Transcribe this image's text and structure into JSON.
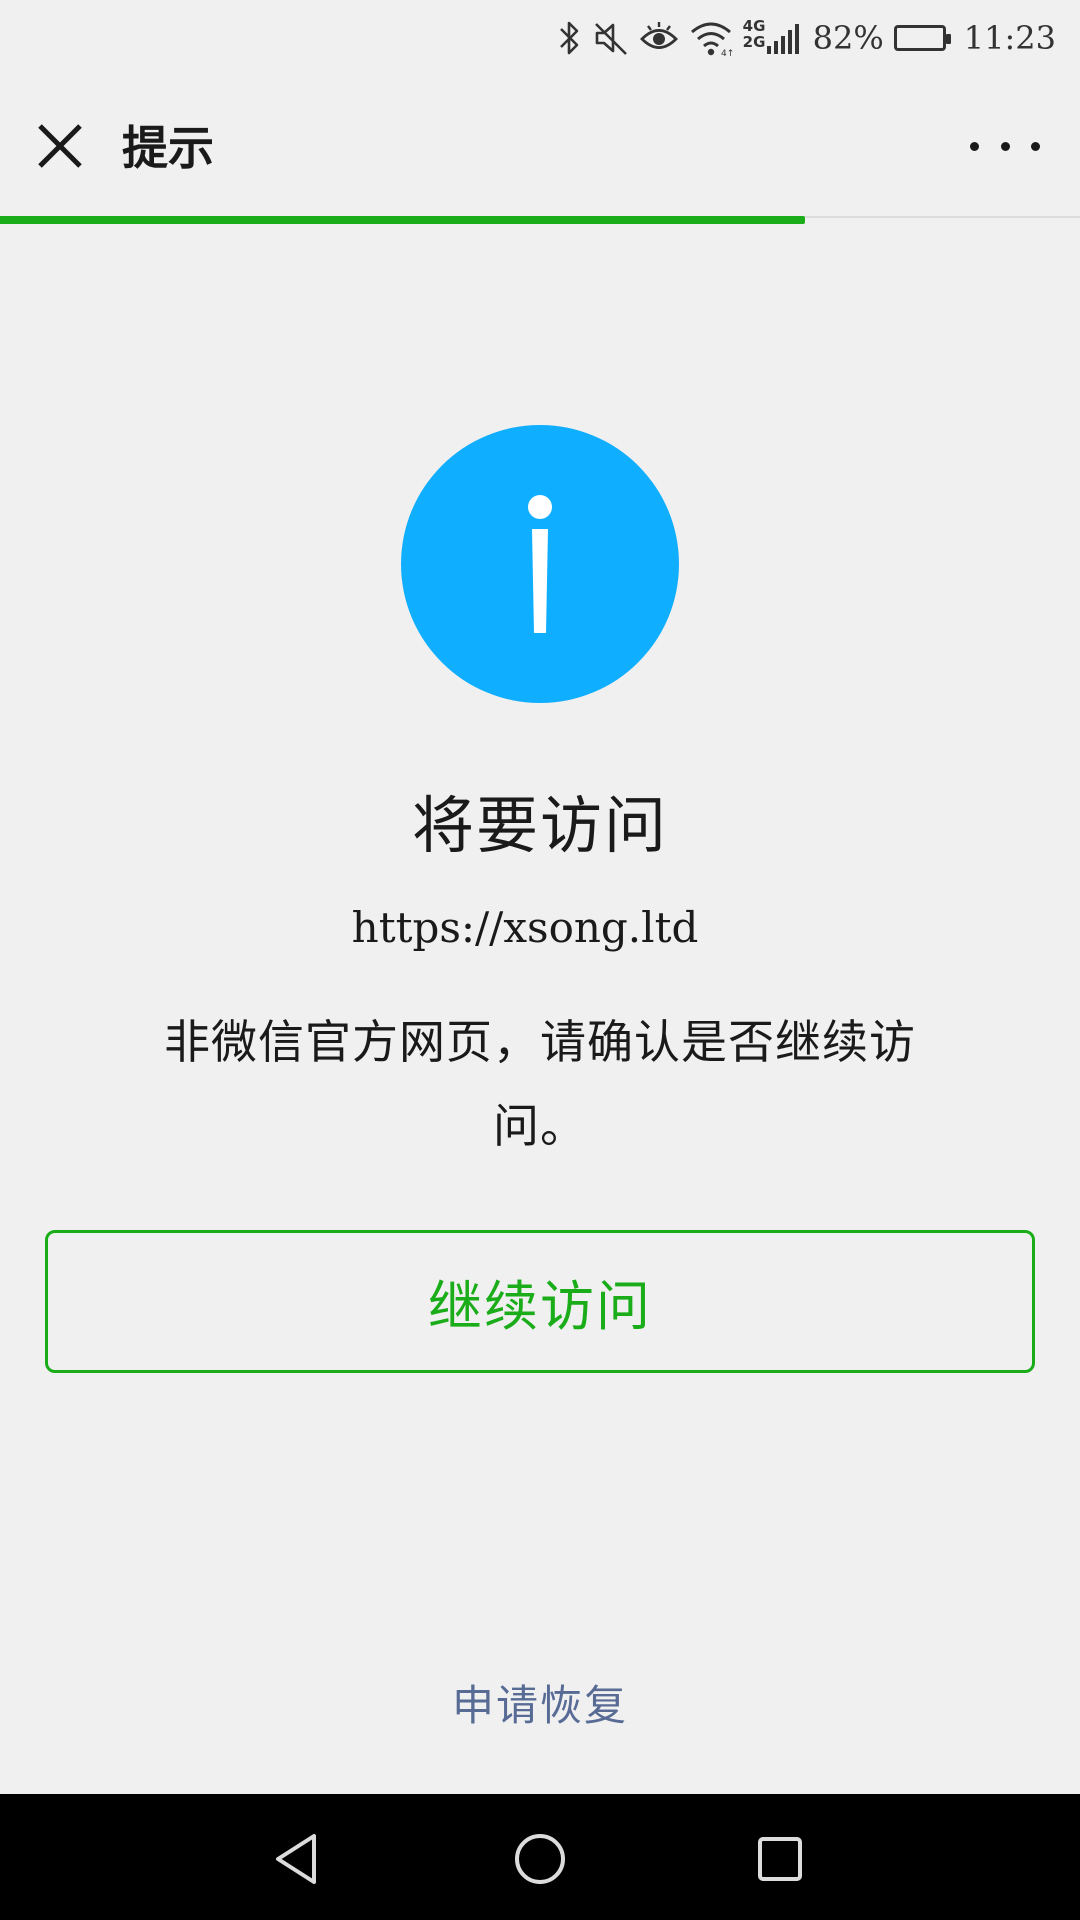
{
  "status_bar": {
    "icons": [
      "bluetooth-icon",
      "mute-icon",
      "eye-icon",
      "wifi-icon",
      "cellular-signal-icon",
      "battery-icon"
    ],
    "network_top": "4G",
    "network_bottom": "2G",
    "battery_percent": "82%",
    "battery_level": 0.82,
    "time": "11:23"
  },
  "nav": {
    "close_icon": "close-icon",
    "title": "提示",
    "more_icon": "more-icon",
    "load_progress": 0.745
  },
  "content": {
    "icon": "info-icon",
    "icon_color": "#10aeff",
    "headline": "将要访问",
    "url": "https://xsong.ltd",
    "warning": "非微信官方网页，请确认是否继续访问。",
    "continue_label": "继续访问",
    "appeal_label": "申请恢复"
  },
  "colors": {
    "accent_green": "#1aad19",
    "link_blue": "#576b95"
  },
  "system_nav": {
    "icons": [
      "back-icon",
      "home-icon",
      "recents-icon"
    ]
  }
}
